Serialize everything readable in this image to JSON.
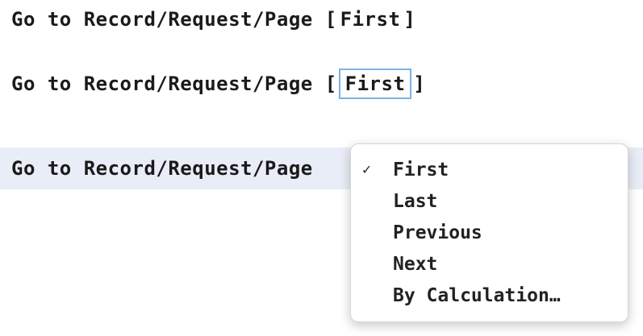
{
  "steps": [
    {
      "command": "Go to Record/Request/Page",
      "open_bracket": "[",
      "param": "First",
      "close_bracket": "]"
    },
    {
      "command": "Go to Record/Request/Page",
      "open_bracket": "[",
      "param": "First",
      "close_bracket": "]"
    },
    {
      "command": "Go to Record/Request/Page"
    }
  ],
  "menu": {
    "selected": "First",
    "check_icon": "✓",
    "options": [
      "First",
      "Last",
      "Previous",
      "Next",
      "By Calculation…"
    ]
  }
}
